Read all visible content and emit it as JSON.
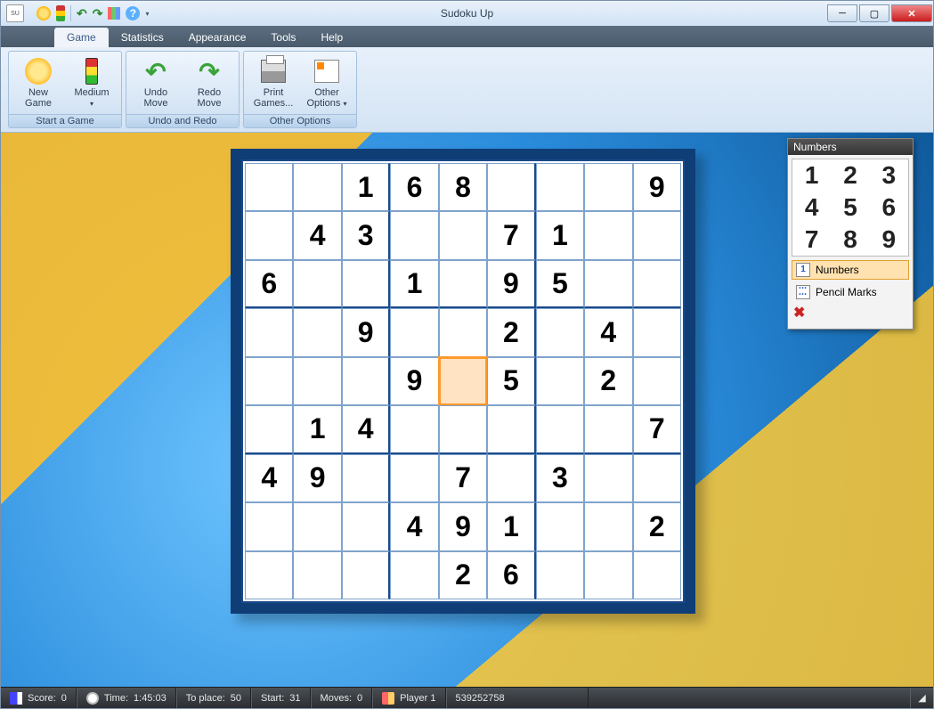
{
  "window": {
    "title": "Sudoku Up"
  },
  "tabs": {
    "game": "Game",
    "statistics": "Statistics",
    "appearance": "Appearance",
    "tools": "Tools",
    "help": "Help",
    "active": "game"
  },
  "ribbon": {
    "groups": {
      "start": {
        "footer": "Start a Game",
        "newgame": "New\nGame",
        "difficulty": "Medium"
      },
      "undo": {
        "footer": "Undo and Redo",
        "undo": "Undo\nMove",
        "redo": "Redo\nMove"
      },
      "other": {
        "footer": "Other Options",
        "print": "Print\nGames...",
        "options": "Other\nOptions"
      }
    }
  },
  "board": {
    "selected": [
      4,
      4
    ],
    "cells": [
      [
        "",
        "",
        "1",
        "6",
        "8",
        "",
        "",
        "",
        "9"
      ],
      [
        "",
        "4",
        "3",
        "",
        "",
        "7",
        "1",
        "",
        ""
      ],
      [
        "6",
        "",
        "",
        "1",
        "",
        "9",
        "5",
        "",
        ""
      ],
      [
        "",
        "",
        "9",
        "",
        "",
        "2",
        "",
        "4",
        ""
      ],
      [
        "",
        "",
        "",
        "9",
        "",
        "5",
        "",
        "2",
        ""
      ],
      [
        "",
        "1",
        "4",
        "",
        "",
        "",
        "",
        "",
        "7"
      ],
      [
        "4",
        "9",
        "",
        "",
        "7",
        "",
        "3",
        "",
        ""
      ],
      [
        "",
        "",
        "",
        "4",
        "9",
        "1",
        "",
        "",
        "2"
      ],
      [
        "",
        "",
        "",
        "",
        "2",
        "6",
        "",
        "",
        ""
      ]
    ]
  },
  "numbers_panel": {
    "title": "Numbers",
    "picks": [
      "1",
      "2",
      "3",
      "4",
      "5",
      "6",
      "7",
      "8",
      "9"
    ],
    "mode_numbers": "Numbers",
    "mode_pencil": "Pencil Marks",
    "active_mode": "numbers"
  },
  "status": {
    "score_label": "Score:",
    "score_value": "0",
    "time_label": "Time:",
    "time_value": "1:45:03",
    "toplace_label": "To place:",
    "toplace_value": "50",
    "start_label": "Start:",
    "start_value": "31",
    "moves_label": "Moves:",
    "moves_value": "0",
    "player_label": "Player 1",
    "game_id": "539252758"
  }
}
